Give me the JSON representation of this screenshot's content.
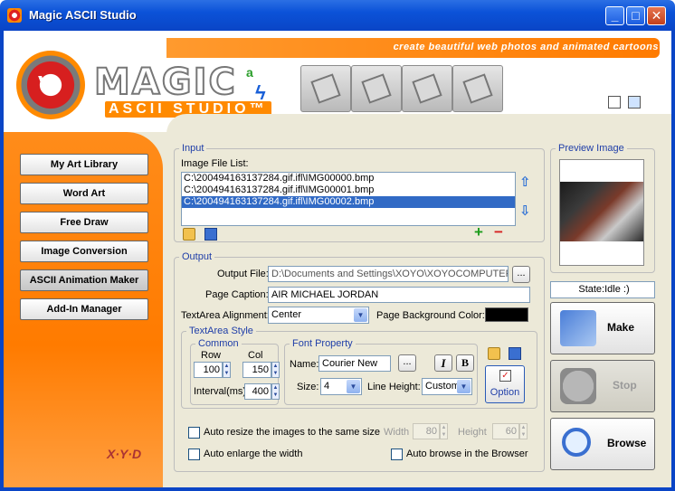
{
  "window": {
    "title": "Magic ASCII Studio",
    "minimize": "_",
    "maximize": "□",
    "close": "✕"
  },
  "banner": {
    "tagline": "create beautiful web photos and animated cartoons",
    "logo_main": "MAGIC",
    "logo_sup": "a",
    "logo_sub": "ASCII STUDIO™",
    "logo_mark": "V",
    "bolt": "ϟ"
  },
  "sidebar": {
    "items": [
      {
        "label": "My Art Library"
      },
      {
        "label": "Word Art"
      },
      {
        "label": "Free Draw"
      },
      {
        "label": "Image Conversion"
      },
      {
        "label": "ASCII Animation Maker"
      },
      {
        "label": "Add-In Manager"
      }
    ],
    "brand": "X·Y·D"
  },
  "input": {
    "legend": "Input",
    "list_label": "Image File List:",
    "files": [
      "C:\\200494163137284.gif.ifl\\IMG00000.bmp",
      "C:\\200494163137284.gif.ifl\\IMG00001.bmp",
      "C:\\200494163137284.gif.ifl\\IMG00002.bmp"
    ],
    "up_arrow": "⇧",
    "down_arrow": "⇩",
    "add": "+",
    "remove": "−"
  },
  "output": {
    "legend": "Output",
    "file_label": "Output File:",
    "file_value": "D:\\Documents and Settings\\XOYO\\XOYOCOMPUTER\\",
    "browse_dots": "...",
    "caption_label": "Page Caption:",
    "caption_value": "AIR MICHAEL JORDAN",
    "align_label": "TextArea Alignment:",
    "align_value": "Center",
    "bg_label": "Page Background Color:",
    "bg_color": "#000000"
  },
  "style": {
    "legend": "TextArea Style",
    "common": {
      "legend": "Common",
      "row_label": "Row",
      "row_value": "100",
      "col_label": "Col",
      "col_value": "150",
      "interval_label": "Interval(ms)",
      "interval_value": "400"
    },
    "font": {
      "legend": "Font Property",
      "name_label": "Name:",
      "name_value": "Courier New",
      "dots": "...",
      "italic": "I",
      "bold": "B",
      "size_label": "Size:",
      "size_value": "4",
      "line_label": "Line Height:",
      "line_value": "Custom"
    },
    "option_label": "Option"
  },
  "options": {
    "resize_label": "Auto resize the images to the same size",
    "width_label": "Width",
    "width_value": "80",
    "height_label": "Height",
    "height_value": "60",
    "enlarge_label": "Auto enlarge the width",
    "browse_label": "Auto browse in the Browser"
  },
  "preview": {
    "legend": "Preview Image",
    "state": "State:Idle :)"
  },
  "actions": {
    "make": "Make",
    "stop": "Stop",
    "browse": "Browse"
  },
  "colors": {
    "accent_orange": "#ff7b00",
    "selection": "#316ac5",
    "group_legend": "#1f3ea8"
  }
}
